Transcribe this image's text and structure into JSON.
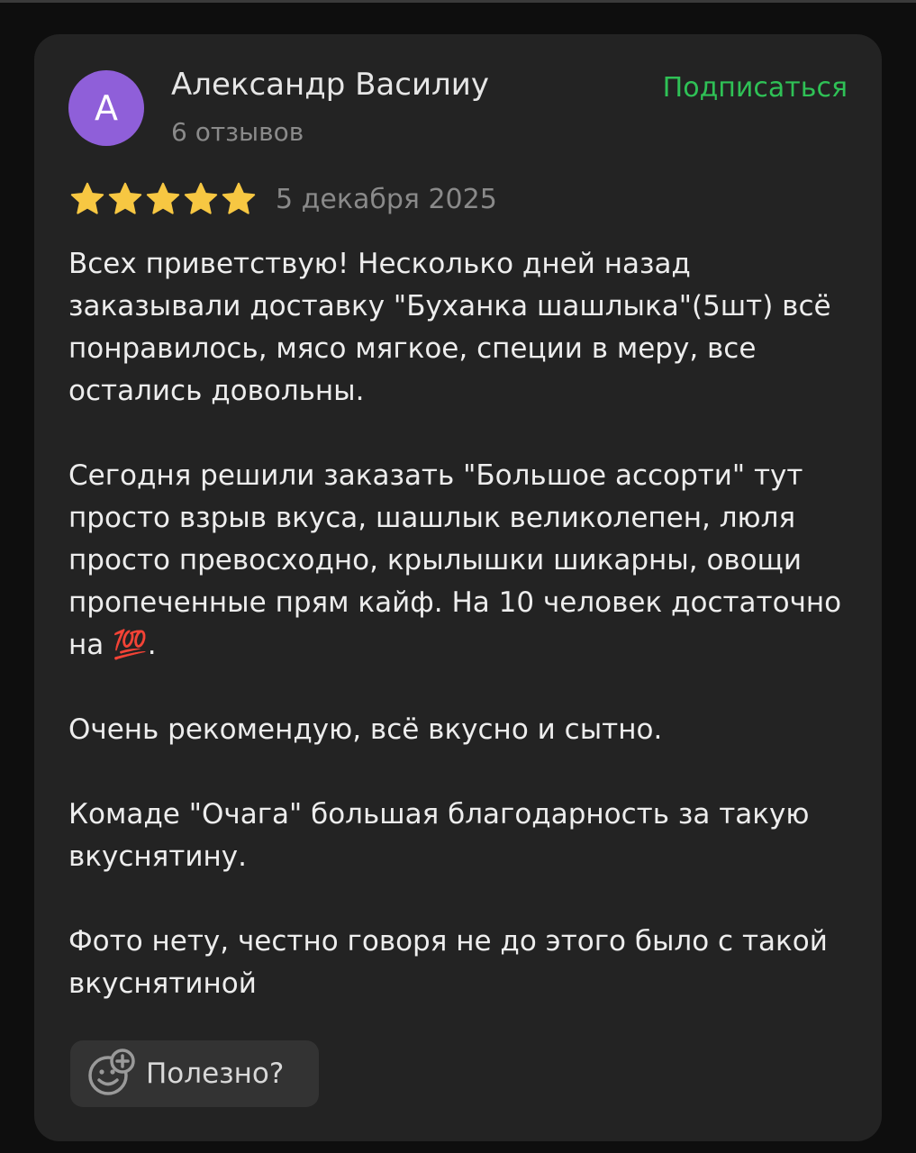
{
  "review": {
    "author": {
      "initial": "А",
      "name": "Александр Василиу",
      "reviews_count": "6 отзывов",
      "avatar_color": "#8f5fd9"
    },
    "subscribe_label": "Подписаться",
    "rating": 5,
    "rating_max": 5,
    "date": "5 декабря 2025",
    "paragraphs": [
      "Всех приветствую! Несколько дней назад заказывали доставку \"Буханка шашлыка\"(5шт) всё понравилось, мясо мягкое, специи в меру, все остались довольны.",
      "Сегодня решили заказать \"Большое ассорти\" тут просто взрыв вкуса, шашлык великолепен, люля просто превосходно, крылышки шикарны, овощи пропеченные прям кайф. На 10 человек достаточно на 💯.",
      "Очень рекомендую, всё вкусно и сытно.",
      "Комаде \"Очага\" большая благодарность за такую вкуснятину.",
      "Фото нету, честно говоря не до этого было с такой вкуснятиной"
    ],
    "useful_label": "Полезно?"
  },
  "colors": {
    "accent_green": "#2fc156",
    "star_gold": "#f7c742",
    "card_bg": "#232323",
    "page_bg": "#0e0e0e"
  },
  "icons": {
    "star": "star-icon",
    "useful": "smile-plus-icon"
  }
}
